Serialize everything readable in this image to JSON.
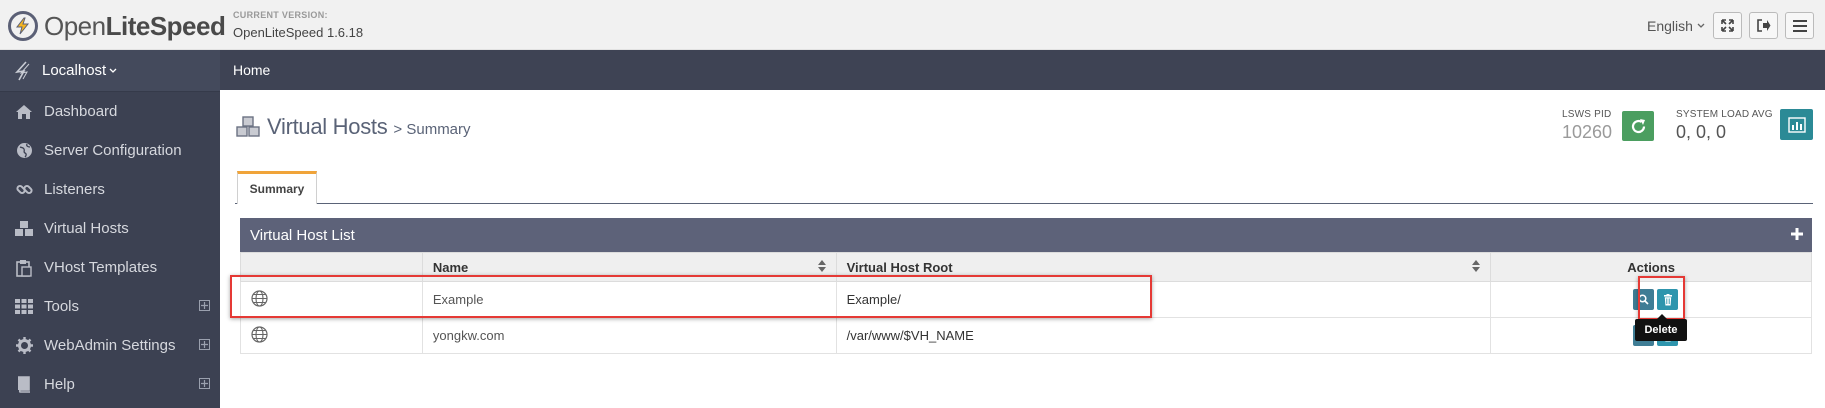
{
  "brand": {
    "name_light": "Open",
    "name_bold": "LiteSpeed"
  },
  "version": {
    "label": "CURRENT VERSION:",
    "value": "OpenLiteSpeed 1.6.18"
  },
  "header": {
    "language": "English",
    "icons": [
      "expand-icon",
      "logout-icon",
      "menu-icon"
    ]
  },
  "sidebar": {
    "host": "Localhost",
    "items": [
      {
        "label": "Dashboard",
        "icon": "home-icon",
        "expandable": false
      },
      {
        "label": "Server Configuration",
        "icon": "globe-icon",
        "expandable": false
      },
      {
        "label": "Listeners",
        "icon": "link-icon",
        "expandable": false
      },
      {
        "label": "Virtual Hosts",
        "icon": "cubes-icon",
        "expandable": false
      },
      {
        "label": "VHost Templates",
        "icon": "clipboard-icon",
        "expandable": false
      },
      {
        "label": "Tools",
        "icon": "grid-icon",
        "expandable": true
      },
      {
        "label": "WebAdmin Settings",
        "icon": "gear-icon",
        "expandable": true
      },
      {
        "label": "Help",
        "icon": "book-icon",
        "expandable": true
      }
    ]
  },
  "breadcrumb": {
    "home": "Home"
  },
  "page": {
    "title": "Virtual Hosts",
    "subtitle": "> Summary"
  },
  "stats": {
    "pid_label": "LSWS PID",
    "pid_value": "10260",
    "load_label": "SYSTEM LOAD AVG",
    "load_value": "0, 0, 0"
  },
  "tabs": [
    {
      "label": "Summary",
      "active": true
    }
  ],
  "panel": {
    "title": "Virtual Host List",
    "columns": [
      "Name",
      "Virtual Host Root",
      "Actions"
    ],
    "rows": [
      {
        "name": "Example",
        "root": "Example/"
      },
      {
        "name": "yongkw.com",
        "root": "/var/www/$VH_NAME"
      }
    ]
  },
  "tooltip": {
    "text": "Delete"
  },
  "colors": {
    "sidebar": "#3c4152",
    "panel_header": "#5d6279",
    "accent_tab": "#f0a43a",
    "teal": "#2b8a96",
    "action": "#3f7d95",
    "highlight": "#e53935"
  }
}
